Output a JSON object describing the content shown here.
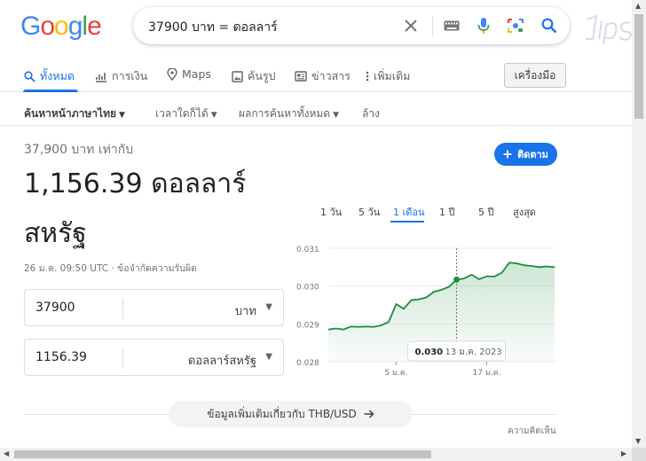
{
  "search": {
    "query": "37900 บาท = ดอลลาร์"
  },
  "logo": {
    "letters": [
      "G",
      "o",
      "o",
      "g",
      "l",
      "e"
    ],
    "colors": [
      "#4285f4",
      "#ea4335",
      "#fbbc05",
      "#4285f4",
      "#34a853",
      "#ea4335"
    ]
  },
  "tabs": [
    {
      "label": "ทั้งหมด",
      "icon": "search-icon"
    },
    {
      "label": "การเงิน",
      "icon": "finance-icon"
    },
    {
      "label": "Maps",
      "icon": "map-pin-icon"
    },
    {
      "label": "ค้นรูป",
      "icon": "image-icon"
    },
    {
      "label": "ข่าวสาร",
      "icon": "news-icon"
    },
    {
      "label": "เพิ่มเติม",
      "icon": "more-vert-icon"
    }
  ],
  "tools_label": "เครื่องมือ",
  "filters": [
    "ค้นหาหน้าภาษาไทย",
    "เวลาใดก็ได้",
    "ผลการค้นหาทั้งหมด",
    "ล้าง"
  ],
  "result": {
    "equals_text": "37,900 บาท เท่ากับ",
    "value_line1": "1,156.39 ดอลลาร์",
    "value_line2": "สหรัฐ",
    "timestamp": "26 ม.ค. 09:50 UTC · ข้อจำกัดความรับผิด",
    "follow_label": "ติดตาม"
  },
  "converter": {
    "from_value": "37900",
    "from_unit": "บาท",
    "to_value": "1156.39",
    "to_unit": "ดอลลาร์สหรัฐ"
  },
  "ranges": [
    "1 วัน",
    "5 วัน",
    "1 เดือน",
    "1 ปี",
    "5 ปี",
    "สูงสุด"
  ],
  "active_range": 2,
  "chart_data": {
    "type": "area",
    "y_ticks": [
      "0.031",
      "0.030",
      "0.029",
      "0.028"
    ],
    "ylim": [
      0.028,
      0.031
    ],
    "x_ticks": [
      "5 ม.ค.",
      "17 ม.ค."
    ],
    "values": [
      0.02885,
      0.02888,
      0.02885,
      0.02893,
      0.02892,
      0.02893,
      0.02892,
      0.02896,
      0.02905,
      0.02952,
      0.0294,
      0.02963,
      0.02965,
      0.0297,
      0.02985,
      0.0299,
      0.02998,
      0.03017,
      0.0302,
      0.0303,
      0.03018,
      0.03026,
      0.03025,
      0.03035,
      0.03062,
      0.0306,
      0.03055,
      0.03053,
      0.0305,
      0.03052,
      0.0305
    ],
    "highlight_index": 17,
    "tooltip_value": "0.030",
    "tooltip_date": "13 ม.ค. 2023",
    "color": "#1e8e3e"
  },
  "more_info_label": "ข้อมูลเพิ่มเติมเกี่ยวกับ THB/USD",
  "feedback_label": "ความคิดเห็น"
}
